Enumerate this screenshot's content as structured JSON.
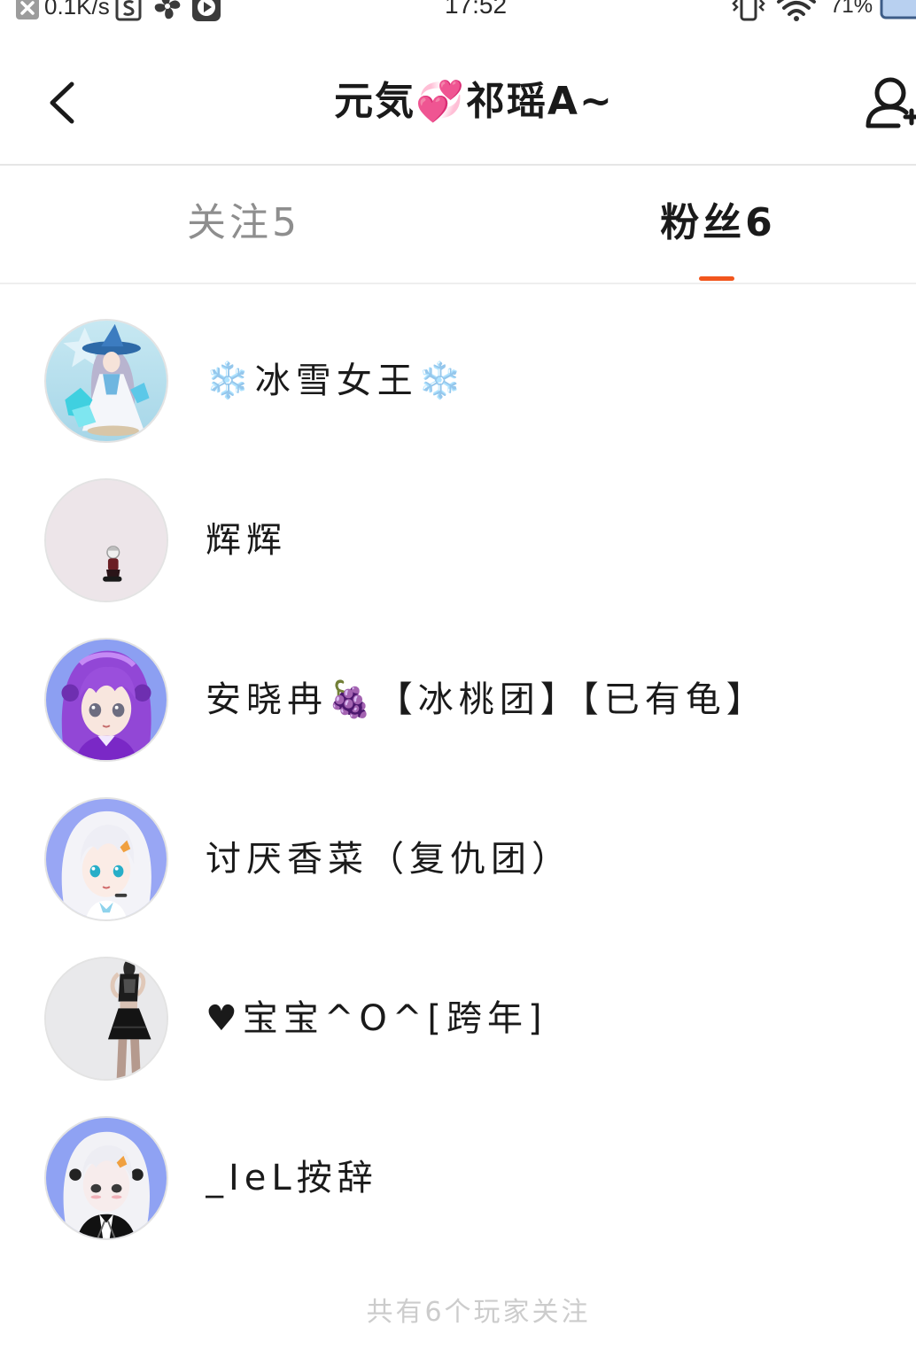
{
  "status_bar": {
    "network_speed": "0.1K/s",
    "time": "17:52",
    "battery": "71%",
    "icons": [
      "notification-dismiss-icon",
      "screenshot-icon",
      "pinwheel-icon",
      "play-icon",
      "vibrate-icon",
      "wifi-icon",
      "battery-icon"
    ]
  },
  "header": {
    "title": "元気💞祁瑶A~",
    "back_icon": "back-arrow-icon",
    "action_icon": "add-user-icon"
  },
  "tabs": [
    {
      "label": "关注5",
      "active": false
    },
    {
      "label": "粉丝6",
      "active": true
    }
  ],
  "followers": [
    {
      "name": "❄️冰雪女王❄️"
    },
    {
      "name": "辉辉"
    },
    {
      "name": "安晓冉🍇【冰桃团】【已有龟】"
    },
    {
      "name": "讨厌香菜（复仇团）"
    },
    {
      "name": "♥宝宝^O^[跨年]"
    },
    {
      "name": "_IeL按辞"
    }
  ],
  "footer": {
    "summary": "共有6个玩家关注"
  },
  "theme": {
    "accent": "#f2561d",
    "text": "#1a1a1a",
    "inactive_tab": "#8e8e8e",
    "footer_text": "#cccccc",
    "divider": "#e6e6e6",
    "background": "#ffffff"
  }
}
